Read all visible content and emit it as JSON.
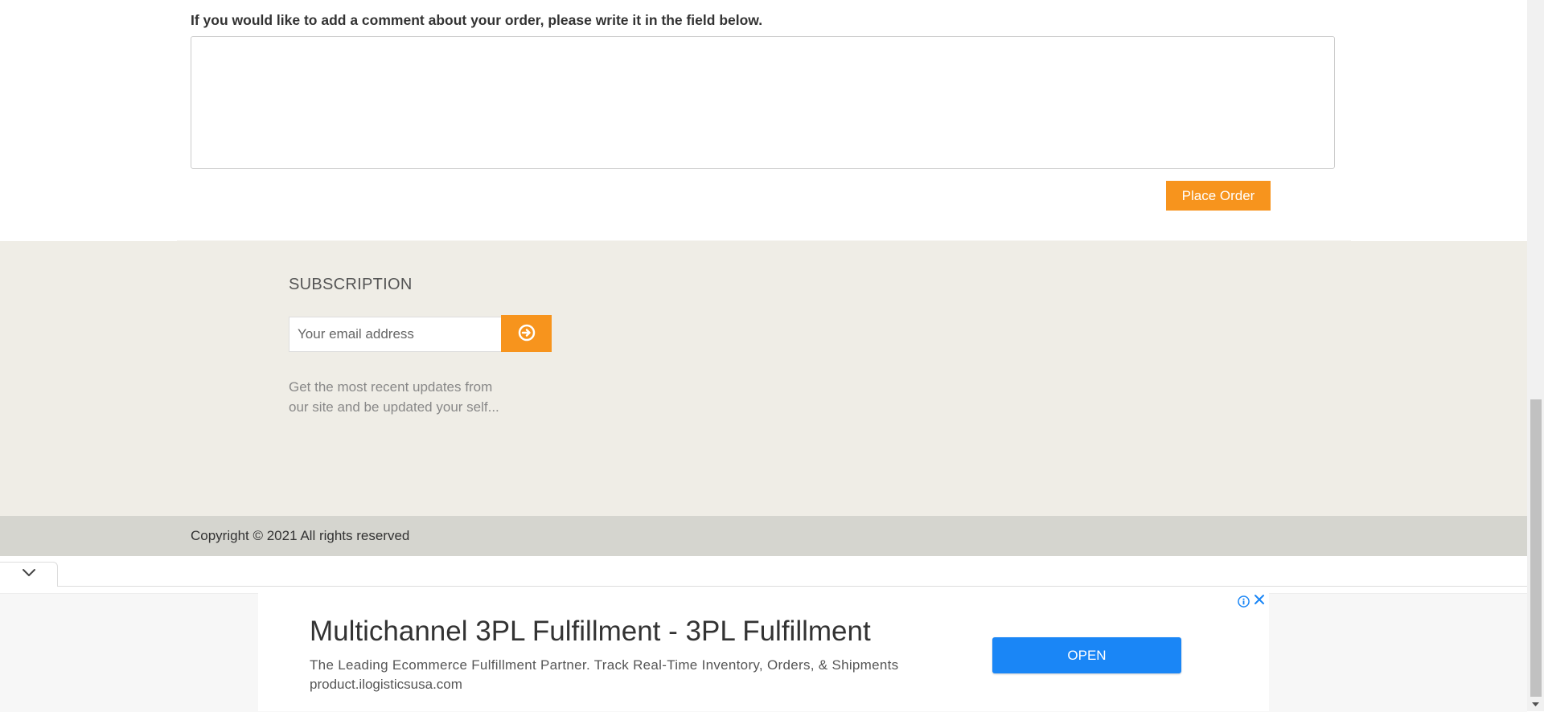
{
  "comment": {
    "label": "If you would like to add a comment about your order, please write it in the field below.",
    "value": "",
    "place_order_label": "Place Order"
  },
  "subscription": {
    "title": "SUBSCRIPTION",
    "email_placeholder": "Your email address",
    "submit_icon": "arrow-circle-right-icon",
    "description_line1": "Get the most recent updates from",
    "description_line2": "our site and be updated your self..."
  },
  "footer": {
    "copyright": "Copyright © 2021 All rights reserved"
  },
  "ad": {
    "toggle_icon": "chevron-down-icon",
    "title": "Multichannel 3PL Fulfillment - 3PL Fulfillment",
    "description": "The Leading Ecommerce Fulfillment Partner. Track Real-Time Inventory, Orders, & Shipments",
    "url": "product.ilogisticsusa.com",
    "open_label": "OPEN",
    "info_icon": "info-icon",
    "close_icon": "close-icon"
  },
  "colors": {
    "accent_orange": "#f7941d",
    "subscription_bg": "#efede6",
    "copyright_bg": "#d5d5cf",
    "ad_button_blue": "#1a86f6"
  }
}
